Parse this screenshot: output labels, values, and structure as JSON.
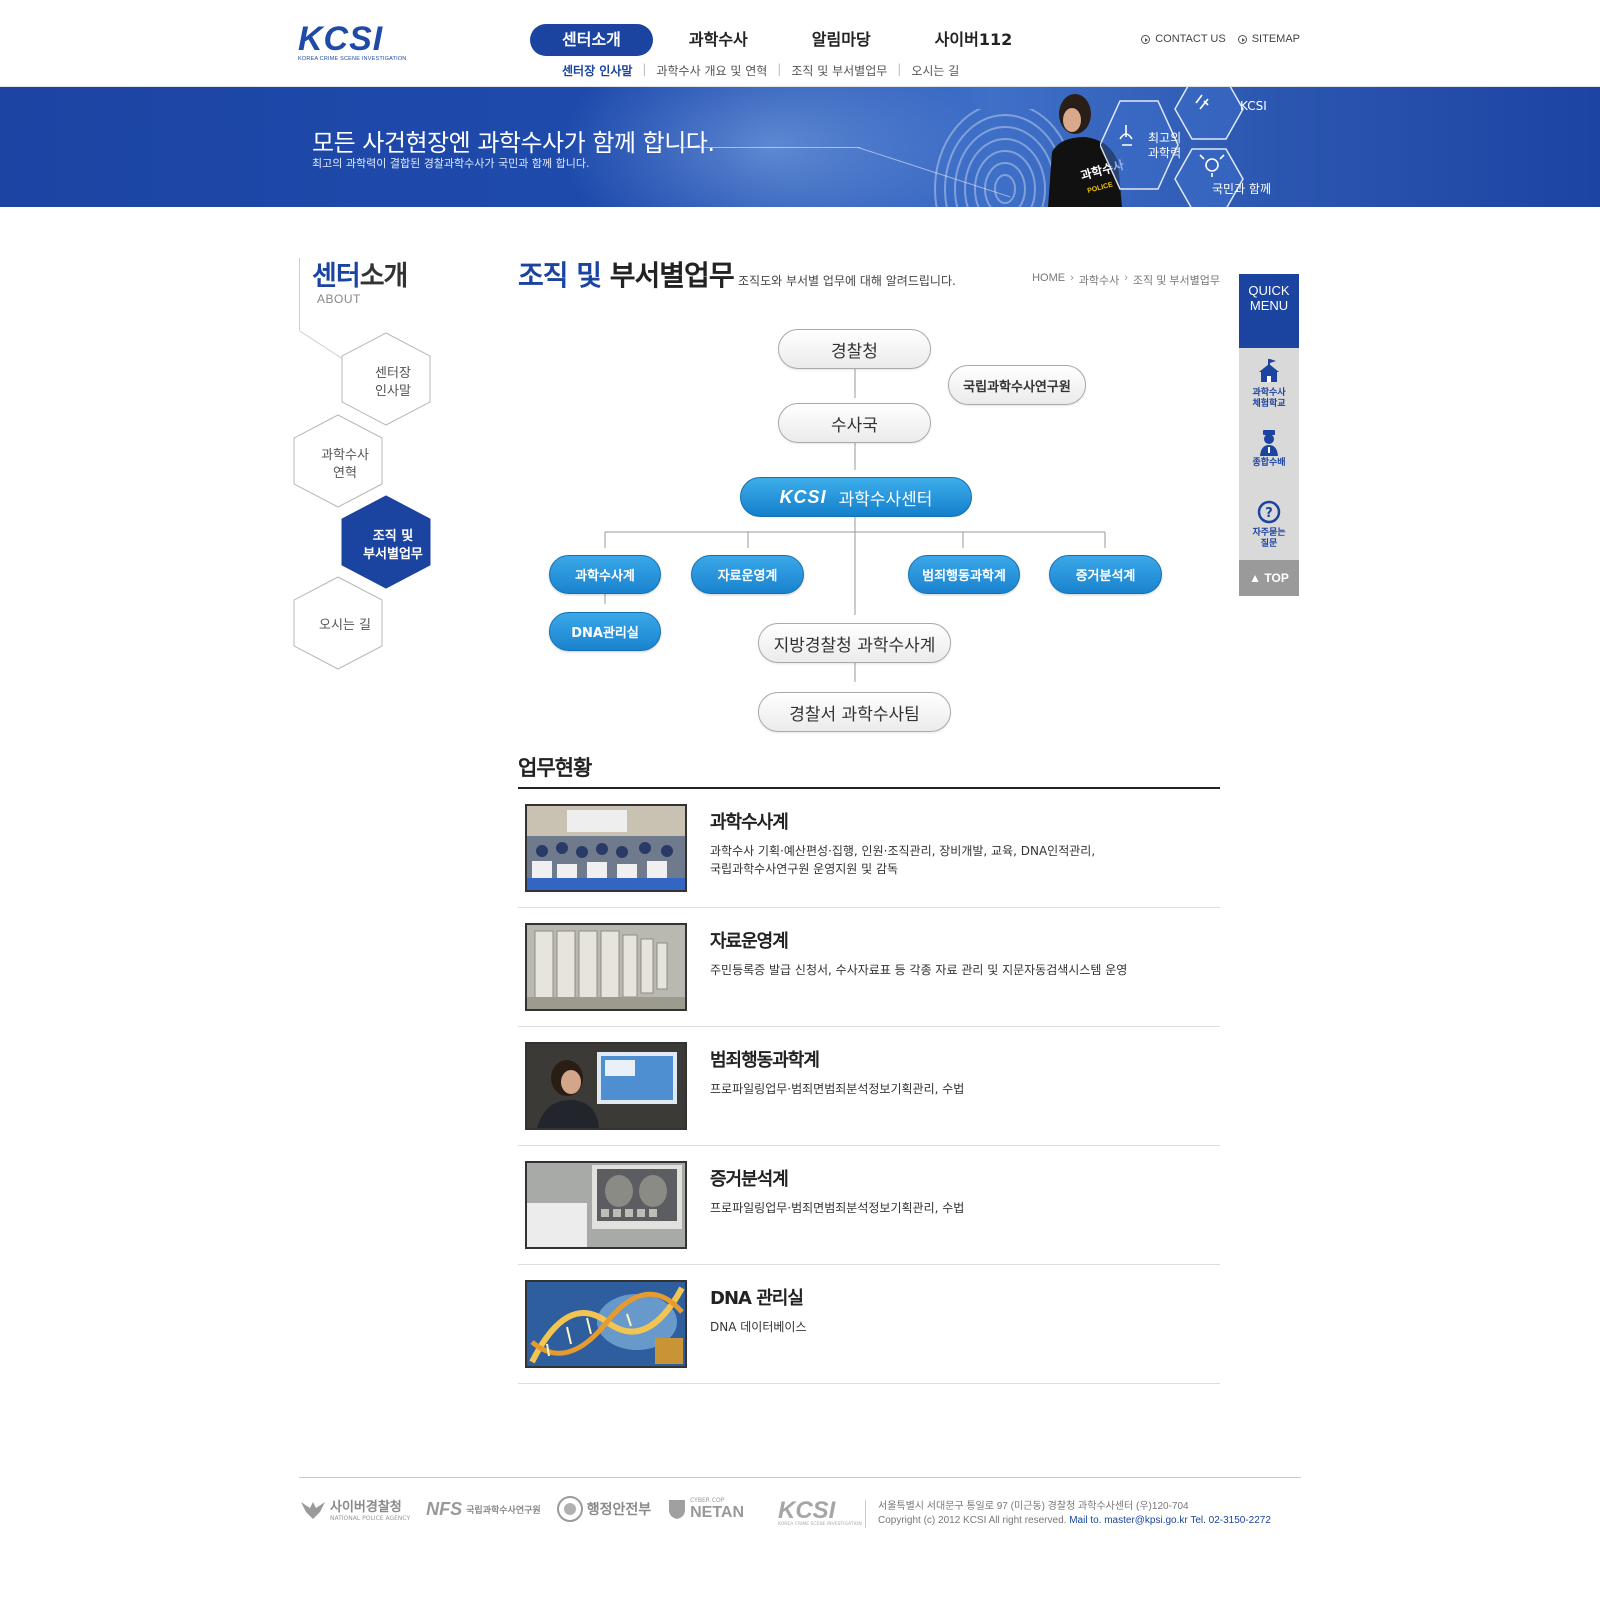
{
  "header": {
    "logo_text": "KCSI",
    "logo_sub": "KOREA CRIME SCENE INVESTIGATION",
    "gnb": [
      "센터소개",
      "과학수사",
      "알림마당",
      "사이버112"
    ],
    "sub_gnb": [
      "센터장 인사말",
      "과학수사 개요 및 연혁",
      "조직 및 부서별업무",
      "오시는 길"
    ],
    "util": [
      "CONTACT US",
      "SITEMAP"
    ]
  },
  "banner": {
    "title": "모든 사건현장엔 과학수사가 함께 합니다.",
    "subtitle": "최고의 과학력이 결합된 경찰과학수사가 국민과 함께 합니다.",
    "hex_labels": [
      "KCSI",
      "최고의\n과학력",
      "국민과 함께"
    ],
    "officer_text": "과학수사",
    "officer_sub": "POLICE"
  },
  "lnb": {
    "title_a": "센터",
    "title_b": "소개",
    "sub": "ABOUT",
    "items": [
      "센터장\n인사말",
      "과학수사\n연혁",
      "조직 및\n부서별업무",
      "오시는 길"
    ],
    "active_index": 2
  },
  "content": {
    "title_a": "조직 및",
    "title_b": "부서별업무",
    "desc": "조직도와 부서별 업무에 대해 알려드립니다.",
    "breadcrumb": [
      "HOME",
      "과학수사",
      "조직 및 부서별업무"
    ]
  },
  "org": {
    "top": "경찰청",
    "side": "국립과학수사연구원",
    "bureau": "수사국",
    "center_logo": "KCSI",
    "center": "과학수사센터",
    "units": [
      "과학수사계",
      "자료운영계",
      "범죄행동과학계",
      "증거분석계"
    ],
    "dna": "DNA관리실",
    "regional": "지방경찰청 과학수사계",
    "station": "경찰서 과학수사팀"
  },
  "status": {
    "title": "업무현황",
    "items": [
      {
        "name": "과학수사계",
        "desc": "과학수사 기획·예산편성·집행, 인원·조직관리, 장비개발, 교육, DNA인적관리,\n국립과학수사연구원 운영지원 및 감독"
      },
      {
        "name": "자료운영계",
        "desc": "주민등록증 발급 신청서, 수사자료표 등 각종 자료 관리 및 지문자동검색시스템 운영"
      },
      {
        "name": "범죄행동과학계",
        "desc": "프로파일링업무·범죄면범죄분석정보기획관리, 수법"
      },
      {
        "name": "증거분석계",
        "desc": "프로파일링업무·범죄면범죄분석정보기획관리, 수법"
      },
      {
        "name": "DNA 관리실",
        "desc": "DNA 데이터베이스"
      }
    ]
  },
  "quick": {
    "head": "QUICK\nMENU",
    "items": [
      "과학수사\n체험학교",
      "종합수배",
      "자주묻는\n질문"
    ],
    "top": "▲ TOP"
  },
  "footer": {
    "logos": [
      {
        "title": "사이버경찰청",
        "sub": "NATIONAL POLICE AGENCY"
      },
      {
        "title": "NFS",
        "sub": "국립과학수사연구원"
      },
      {
        "title": "행정안전부"
      },
      {
        "title": "NETAN",
        "sub": "CYBER COP"
      }
    ],
    "kcsi": "KCSI",
    "kcsi_sub": "KOREA CRIME SCENE INVESTIGATION",
    "address": "서울특별시 서대문구 통일로 97 (미근동) 경찰청 과학수사센터 (우)120-704",
    "copyright": "Copyright (c) 2012 KCSI All right reserved.",
    "contact": "Mail to. master@kpsi.go.kr Tel. 02-3150-2272"
  },
  "colors": {
    "brand": "#1b43a0",
    "org_blue": "#1a83cf"
  }
}
